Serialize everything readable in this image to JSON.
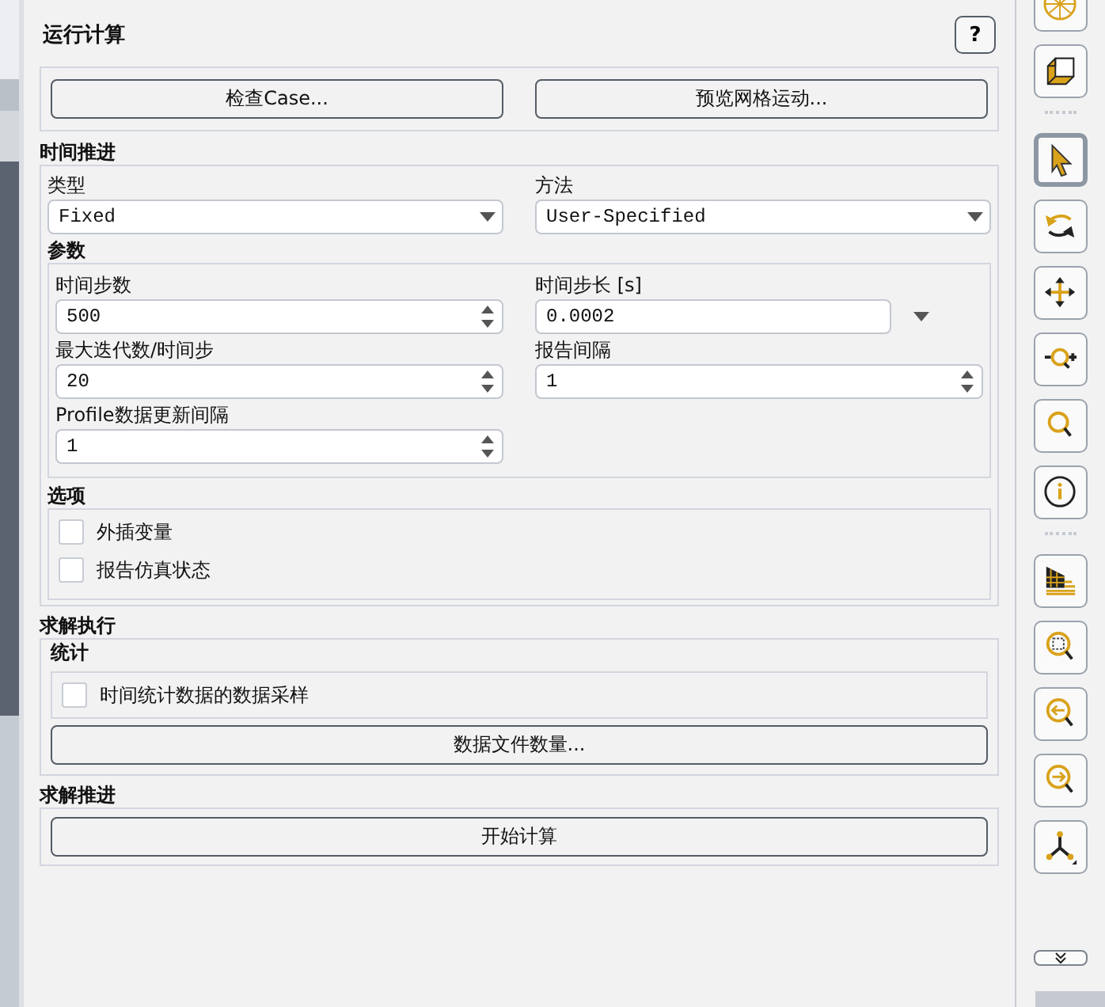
{
  "panel": {
    "title": "运行计算",
    "help": "?"
  },
  "top_buttons": [
    "检查Case...",
    "预览网格运动..."
  ],
  "time_advancement": {
    "heading": "时间推进",
    "type_label": "类型",
    "type_value": "Fixed",
    "method_label": "方法",
    "method_value": "User-Specified"
  },
  "parameters": {
    "heading": "参数",
    "left_fields": [
      {
        "label": "时间步数",
        "value": "500",
        "kind": "spinner"
      },
      {
        "label": "最大迭代数/时间步",
        "value": "20",
        "kind": "spinner"
      },
      {
        "label": "Profile数据更新间隔",
        "value": "1",
        "kind": "spinner"
      }
    ],
    "right_fields": [
      {
        "label": "时间步长 [s]",
        "value": "0.0002",
        "kind": "menu"
      },
      {
        "label": "报告间隔",
        "value": "1",
        "kind": "spinner"
      }
    ]
  },
  "options": {
    "heading": "选项",
    "checkboxes": [
      {
        "label": "外插变量",
        "checked": false
      },
      {
        "label": "报告仿真状态",
        "checked": false
      }
    ]
  },
  "solution_execution": {
    "heading": "求解执行",
    "statistics_heading": "统计",
    "checkboxes": [
      {
        "label": "时间统计数据的数据采样",
        "checked": false
      }
    ],
    "button": "数据文件数量..."
  },
  "solution_advancement": {
    "heading": "求解推进",
    "button": "开始计算"
  },
  "toolbar": {
    "tools": [
      {
        "kind": "sphere",
        "selected": false
      },
      {
        "kind": "cube",
        "selected": false
      },
      {
        "kind": "separator"
      },
      {
        "kind": "pointer",
        "selected": true
      },
      {
        "kind": "rotate",
        "selected": false
      },
      {
        "kind": "pan",
        "selected": false
      },
      {
        "kind": "zoom-in-out",
        "selected": false
      },
      {
        "kind": "zoom",
        "selected": false
      },
      {
        "kind": "info",
        "selected": false
      },
      {
        "kind": "separator"
      },
      {
        "kind": "mesh",
        "selected": false
      },
      {
        "kind": "zoom-box",
        "selected": false
      },
      {
        "kind": "zoom-previous",
        "selected": false
      },
      {
        "kind": "zoom-next",
        "selected": false
      },
      {
        "kind": "axes",
        "selected": false
      }
    ]
  }
}
